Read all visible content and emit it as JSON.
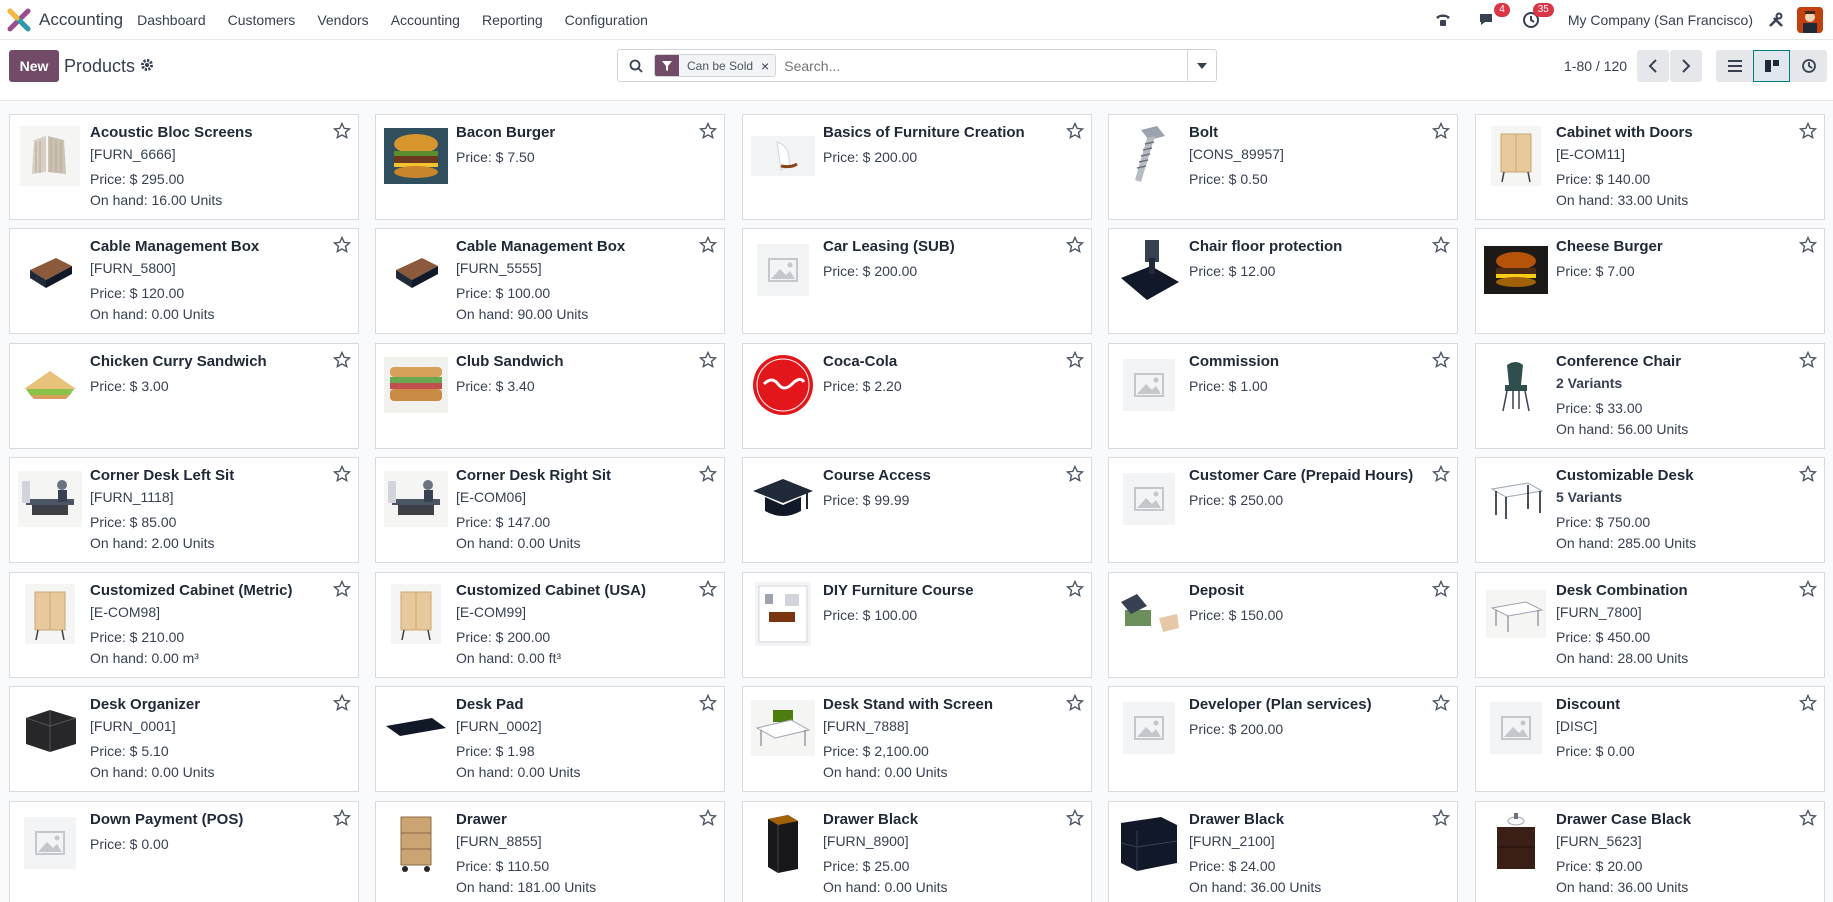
{
  "app": {
    "name": "Accounting"
  },
  "menu": [
    "Dashboard",
    "Customers",
    "Vendors",
    "Accounting",
    "Reporting",
    "Configuration"
  ],
  "nav": {
    "messages_badge": "4",
    "activities_badge": "35",
    "company": "My Company (San Francisco)"
  },
  "control": {
    "new_label": "New",
    "title": "Products",
    "facet_label": "Can be Sold",
    "search_placeholder": "Search...",
    "pager": "1-80 / 120"
  },
  "colors": {
    "brand": "#714b67",
    "accent": "#017e84",
    "badge": "#dc3545"
  },
  "products": [
    {
      "name": "Acoustic Bloc Screens",
      "ref": "[FURN_6666]",
      "price": "Price: $ 295.00",
      "onhand": "On hand: 16.00 Units",
      "img": "screen"
    },
    {
      "name": "Bacon Burger",
      "price": "Price: $ 7.50",
      "img": "burger"
    },
    {
      "name": "Basics of Furniture Creation",
      "price": "Price: $ 200.00",
      "img": "chair-white"
    },
    {
      "name": "Bolt",
      "ref": "[CONS_89957]",
      "price": "Price: $ 0.50",
      "img": "bolt"
    },
    {
      "name": "Cabinet with Doors",
      "ref": "[E-COM11]",
      "price": "Price: $ 140.00",
      "onhand": "On hand: 33.00 Units",
      "img": "cabinet"
    },
    {
      "name": "Cable Management Box",
      "ref": "[FURN_5800]",
      "price": "Price: $ 120.00",
      "onhand": "On hand: 0.00 Units",
      "img": "cable-box"
    },
    {
      "name": "Cable Management Box",
      "ref": "[FURN_5555]",
      "price": "Price: $ 100.00",
      "onhand": "On hand: 90.00 Units",
      "img": "cable-box"
    },
    {
      "name": "Car Leasing (SUB)",
      "price": "Price: $ 200.00",
      "img": "placeholder"
    },
    {
      "name": "Chair floor protection",
      "price": "Price: $ 12.00",
      "img": "floor-mat"
    },
    {
      "name": "Cheese Burger",
      "price": "Price: $ 7.00",
      "img": "burger-dark"
    },
    {
      "name": "Chicken Curry Sandwich",
      "price": "Price: $ 3.00",
      "img": "sandwich"
    },
    {
      "name": "Club Sandwich",
      "price": "Price: $ 3.40",
      "img": "club-sandwich"
    },
    {
      "name": "Coca-Cola",
      "price": "Price: $ 2.20",
      "img": "coca-cola"
    },
    {
      "name": "Commission",
      "price": "Price: $ 1.00",
      "img": "placeholder"
    },
    {
      "name": "Conference Chair",
      "variants": "2 Variants",
      "price": "Price: $ 33.00",
      "onhand": "On hand: 56.00 Units",
      "img": "conf-chair"
    },
    {
      "name": "Corner Desk Left Sit",
      "ref": "[FURN_1118]",
      "price": "Price: $ 85.00",
      "onhand": "On hand: 2.00 Units",
      "img": "desk-person"
    },
    {
      "name": "Corner Desk Right Sit",
      "ref": "[E-COM06]",
      "price": "Price: $ 147.00",
      "onhand": "On hand: 0.00 Units",
      "img": "desk-person"
    },
    {
      "name": "Course Access",
      "price": "Price: $ 99.99",
      "img": "grad-cap"
    },
    {
      "name": "Customer Care (Prepaid Hours)",
      "price": "Price: $ 250.00",
      "img": "placeholder"
    },
    {
      "name": "Customizable Desk",
      "variants": "5 Variants",
      "price": "Price: $ 750.00",
      "onhand": "On hand: 285.00 Units",
      "img": "desk-white"
    },
    {
      "name": "Customized Cabinet (Metric)",
      "ref": "[E-COM98]",
      "price": "Price: $ 210.00",
      "onhand": "On hand: 0.00 m³",
      "img": "cabinet"
    },
    {
      "name": "Customized Cabinet (USA)",
      "ref": "[E-COM99]",
      "price": "Price: $ 200.00",
      "onhand": "On hand: 0.00 ft³",
      "img": "cabinet"
    },
    {
      "name": "DIY Furniture Course",
      "price": "Price: $ 100.00",
      "img": "room"
    },
    {
      "name": "Deposit",
      "price": "Price: $ 150.00",
      "img": "money"
    },
    {
      "name": "Desk Combination",
      "ref": "[FURN_7800]",
      "price": "Price: $ 450.00",
      "onhand": "On hand: 28.00 Units",
      "img": "desk-combo"
    },
    {
      "name": "Desk Organizer",
      "ref": "[FURN_0001]",
      "price": "Price: $ 5.10",
      "onhand": "On hand: 0.00 Units",
      "img": "organizer"
    },
    {
      "name": "Desk Pad",
      "ref": "[FURN_0002]",
      "price": "Price: $ 1.98",
      "onhand": "On hand: 0.00 Units",
      "img": "desk-pad"
    },
    {
      "name": "Desk Stand with Screen",
      "ref": "[FURN_7888]",
      "price": "Price: $ 2,100.00",
      "onhand": "On hand: 0.00 Units",
      "img": "desk-stand"
    },
    {
      "name": "Developer (Plan services)",
      "price": "Price: $ 200.00",
      "img": "placeholder"
    },
    {
      "name": "Discount",
      "ref": "[DISC]",
      "price": "Price: $ 0.00",
      "img": "placeholder"
    },
    {
      "name": "Down Payment (POS)",
      "price": "Price: $ 0.00",
      "img": "placeholder"
    },
    {
      "name": "Drawer",
      "ref": "[FURN_8855]",
      "price": "Price: $ 110.50",
      "onhand": "On hand: 181.00 Units",
      "img": "drawer-wood"
    },
    {
      "name": "Drawer Black",
      "ref": "[FURN_8900]",
      "price": "Price: $ 25.00",
      "onhand": "On hand: 0.00 Units",
      "img": "drawer-black"
    },
    {
      "name": "Drawer Black",
      "ref": "[FURN_2100]",
      "price": "Price: $ 24.00",
      "onhand": "On hand: 36.00 Units",
      "img": "drawer-black-wide"
    },
    {
      "name": "Drawer Case Black",
      "ref": "[FURN_5623]",
      "price": "Price: $ 20.00",
      "onhand": "On hand: 36.00 Units",
      "img": "drawer-case"
    }
  ]
}
